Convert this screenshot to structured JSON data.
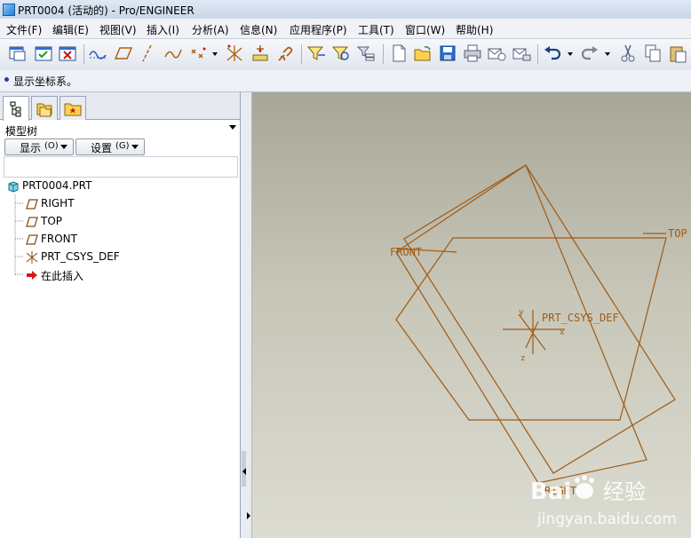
{
  "window": {
    "title": "PRT0004 (活动的) - Pro/ENGINEER"
  },
  "menu": {
    "items": [
      "文件(F)",
      "编辑(E)",
      "视图(V)",
      "插入(I)",
      "分析(A)",
      "信息(N)",
      "应用程序(P)",
      "工具(T)",
      "窗口(W)",
      "帮助(H)"
    ]
  },
  "toolbar": {
    "icons": [
      "window-open-icon",
      "window-activate-icon",
      "window-close-icon",
      "datum-axis-display-icon",
      "datum-plane-display-icon",
      "datum-axis-icon",
      "datum-curve-icon",
      "datum-point-icon",
      "dropdown-arrow-icon",
      "coordinate-system-icon",
      "spin-center-icon",
      "annotation-icon",
      "filter-select-icon",
      "model-display-icon",
      "layer-icon",
      "new-file-icon",
      "open-file-icon",
      "save-icon",
      "print-icon",
      "send-email-icon",
      "mail-attach-icon",
      "undo-icon",
      "redo-icon",
      "cut-icon",
      "copy-icon",
      "paste-icon"
    ]
  },
  "message": {
    "text": "显示坐标系。"
  },
  "model_tree": {
    "tabs": [
      "model-tree-tab",
      "folder-browser-tab",
      "favorites-tab"
    ],
    "header": "模型树",
    "show_button": "显示",
    "show_key": "(O)",
    "settings_button": "设置",
    "settings_key": "(G)",
    "root": "PRT0004.PRT",
    "nodes": [
      "RIGHT",
      "TOP",
      "FRONT",
      "PRT_CSYS_DEF",
      "在此插入"
    ]
  },
  "graphics": {
    "labels": {
      "front": "FRONT",
      "top": "TOP",
      "csys": "PRT_CSYS_DEF",
      "right": "RIGHT",
      "axis_x": "x",
      "axis_y": "y",
      "axis_z": "z"
    },
    "datum_color": "#a05a14"
  },
  "watermark": {
    "brand": "Bai",
    "brand2": "经验",
    "url": "jingyan.baidu.com"
  }
}
